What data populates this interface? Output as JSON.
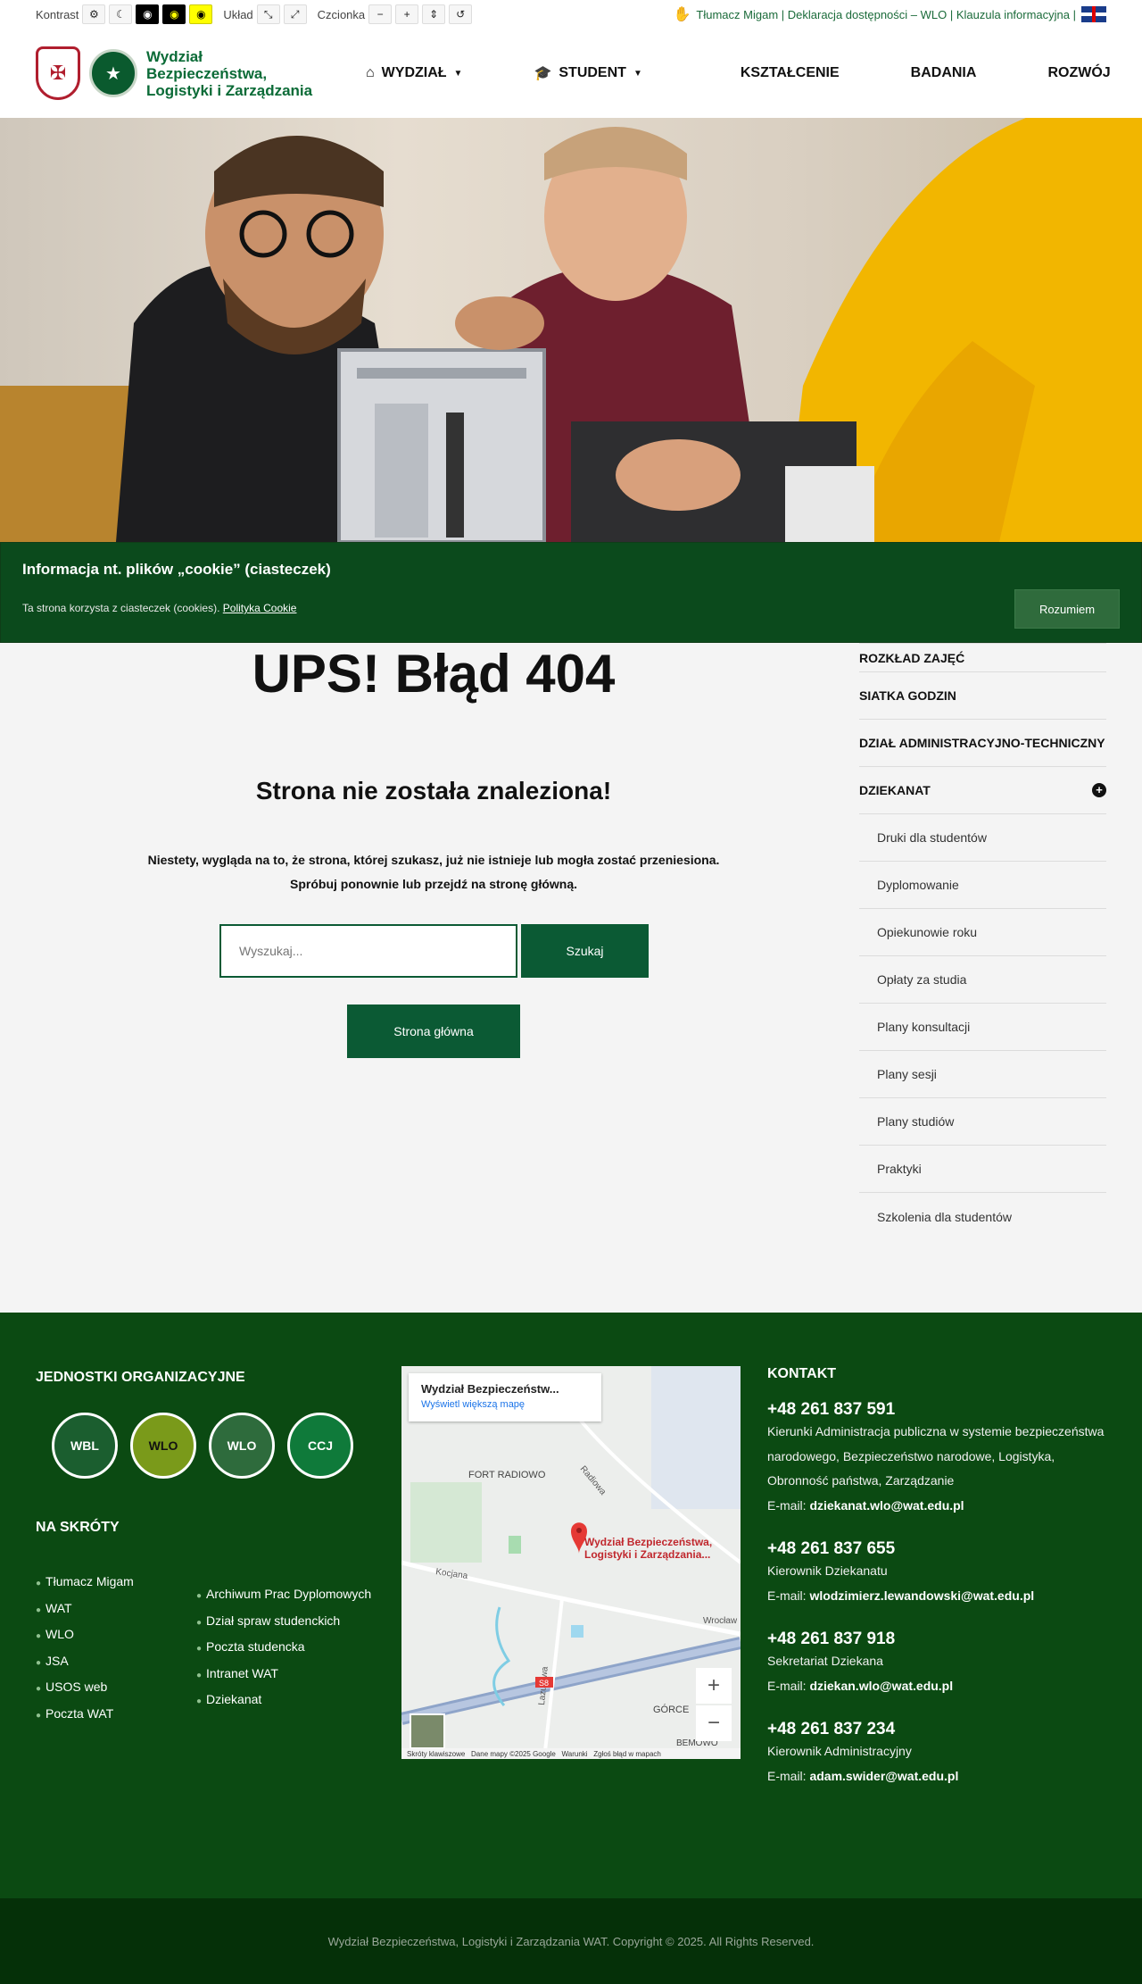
{
  "topbar": {
    "contrast_label": "Kontrast",
    "layout_label": "Układ",
    "font_label": "Czcionka",
    "right_links": "Tłumacz Migam | Deklaracja dostępności – WLO | Klauzula informacyjna |"
  },
  "header": {
    "logo_line1": "Wydział",
    "logo_line2": "Bezpieczeństwa,",
    "logo_line3": "Logistyki i Zarządzania",
    "nav": [
      {
        "label": "WYDZIAŁ",
        "icon": "home-icon",
        "caret": true
      },
      {
        "label": "STUDENT",
        "icon": "graduation-cap-icon",
        "caret": true
      },
      {
        "label": "KSZTAŁCENIE"
      },
      {
        "label": "BADANIA"
      },
      {
        "label": "ROZWÓJ"
      }
    ]
  },
  "cookie": {
    "title": "Informacja nt. plików „cookie” (ciasteczek)",
    "text": "Ta strona korzysta z ciasteczek (cookies).",
    "link": "Polityka Cookie",
    "button": "Rozumiem"
  },
  "main": {
    "title": "UPS! Błąd 404",
    "subtitle": "Strona nie została znaleziona!",
    "text_line1": "Niestety, wygląda na to, że strona, której szukasz, już nie istnieje lub mogła zostać przeniesiona.",
    "text_line2": "Spróbuj ponownie lub przejdź na stronę główną.",
    "search_placeholder": "Wyszukaj...",
    "search_button": "Szukaj",
    "home_button": "Strona główna"
  },
  "sidebar": {
    "items": [
      "ROZKŁAD ZAJĘĆ",
      "SIATKA GODZIN",
      "DZIAŁ ADMINISTRACYJNO-TECHNICZNY",
      "DZIEKANAT"
    ],
    "sub_items": [
      "Druki dla studentów",
      "Dyplomowanie",
      "Opiekunowie roku",
      "Opłaty za studia",
      "Plany konsultacji",
      "Plany sesji",
      "Plany studiów",
      "Praktyki",
      "Szkolenia dla studentów"
    ]
  },
  "footer": {
    "units_title": "JEDNOSTKI ORGANIZACYJNE",
    "badges": [
      "WBL",
      "WLO",
      "WLO",
      "CCJ"
    ],
    "shortcuts_title": "NA SKRÓTY",
    "links_col1": [
      "Tłumacz Migam",
      "WAT",
      "WLO",
      "JSA",
      "USOS web",
      "Poczta WAT"
    ],
    "links_col2": [
      "Archiwum Prac Dyplomowych",
      "Dział spraw studenckich",
      "Poczta studencka",
      "Intranet WAT",
      "Dziekanat"
    ],
    "map": {
      "card_title": "Wydział Bezpieczeństw...",
      "card_link": "Wyświetl większą mapę",
      "pin_label": "Wydział Bezpieczeństwa, Logistyki i Zarządzania...",
      "labels": [
        "FORT RADIOWO",
        "Radiowa",
        "Kocjana",
        "Wrocław",
        "Lazurowa",
        "GÓRCE",
        "BEMOWO",
        "S8"
      ],
      "attribution": "Skróty klawiszowe   Dane mapy ©2025 Google   Warunki   Zgłoś błąd w mapach"
    },
    "contact_title": "KONTAKT",
    "contacts": [
      {
        "phone": "+48 261 837 591",
        "desc": "Kierunki Administracja publiczna w systemie bezpieczeństwa narodowego, Bezpieczeństwo narodowe, Logistyka, Obronność państwa, Zarządzanie",
        "email_label": "E-mail:",
        "email": "dziekanat.wlo@wat.edu.pl"
      },
      {
        "phone": "+48 261 837 655",
        "desc": "Kierownik Dziekanatu",
        "email_label": "E-mail:",
        "email": "wlodzimierz.lewandowski@wat.edu.pl"
      },
      {
        "phone": "+48 261 837 918",
        "desc": "Sekretariat Dziekana",
        "email_label": "E-mail:",
        "email": "dziekan.wlo@wat.edu.pl"
      },
      {
        "phone": "+48 261 837 234",
        "desc": "Kierownik Administracyjny",
        "email_label": "E-mail:",
        "email": "adam.swider@wat.edu.pl"
      }
    ]
  },
  "copyright": "Wydział Bezpieczeństwa, Logistyki i Zarządzania WAT. Copyright © 2025. All Rights Reserved.",
  "colors": {
    "brand_green": "#0b5a34",
    "footer_bg": "#0b4a12",
    "cookie_bg": "#0b4a1c"
  }
}
